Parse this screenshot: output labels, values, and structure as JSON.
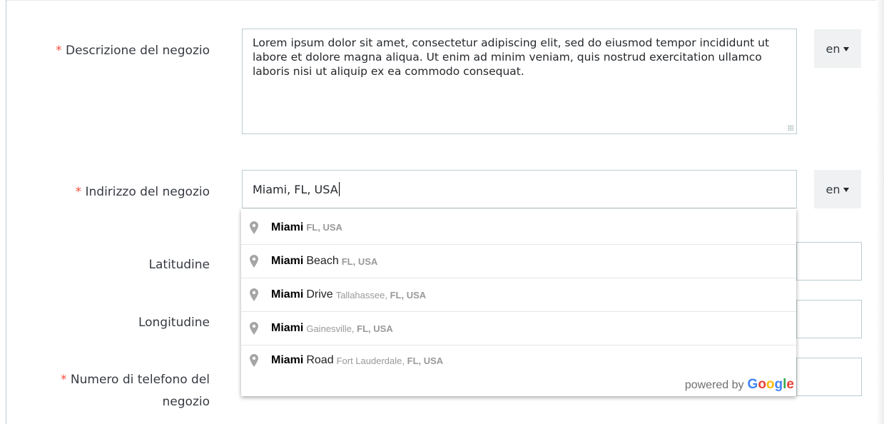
{
  "form": {
    "description": {
      "label": "Descrizione del negozio",
      "required_mark": "*",
      "value": "Lorem ipsum dolor sit amet, consectetur adipiscing elit, sed do eiusmod tempor incididunt ut labore et dolore magna aliqua. Ut enim ad minim veniam, quis nostrud exercitation ullamco laboris nisi ut aliquip ex ea commodo consequat.",
      "lang": "en"
    },
    "address": {
      "label": "Indirizzo del negozio",
      "required_mark": "*",
      "value": "Miami, FL, USA",
      "lang": "en"
    },
    "latitude": {
      "label": "Latitudine"
    },
    "longitude": {
      "label": "Longitudine"
    },
    "phone": {
      "label_line1": "Numero di telefono del",
      "label_line2": "negozio",
      "required_mark": "*"
    }
  },
  "autocomplete": {
    "items": [
      {
        "match": "Miami",
        "rest": "",
        "secondary_plain": "",
        "secondary_bold": "FL, USA",
        "icon": "map-pin-icon"
      },
      {
        "match": "Miami",
        "rest": "Beach",
        "secondary_plain": "",
        "secondary_bold": "FL, USA",
        "icon": "map-pin-icon"
      },
      {
        "match": "Miami",
        "rest": "Drive",
        "secondary_plain": "Tallahassee,",
        "secondary_bold": "FL, USA",
        "icon": "map-pin-icon"
      },
      {
        "match": "Miami",
        "rest": "",
        "secondary_plain": "Gainesville,",
        "secondary_bold": "FL, USA",
        "icon": "map-pin-icon"
      },
      {
        "match": "Miami",
        "rest": "Road",
        "secondary_plain": "Fort Lauderdale,",
        "secondary_bold": "FL, USA",
        "icon": "map-pin-icon"
      }
    ],
    "powered_by": "powered by",
    "logo_letters": [
      "G",
      "o",
      "o",
      "g",
      "l",
      "e"
    ],
    "logo_colors": [
      "#4285F4",
      "#EA4335",
      "#FBBC05",
      "#4285F4",
      "#34A853",
      "#EA4335"
    ]
  },
  "colors": {
    "required": "#f54c3e",
    "border": "#bbcdd2",
    "lang_button_bg": "#eff1f2"
  }
}
